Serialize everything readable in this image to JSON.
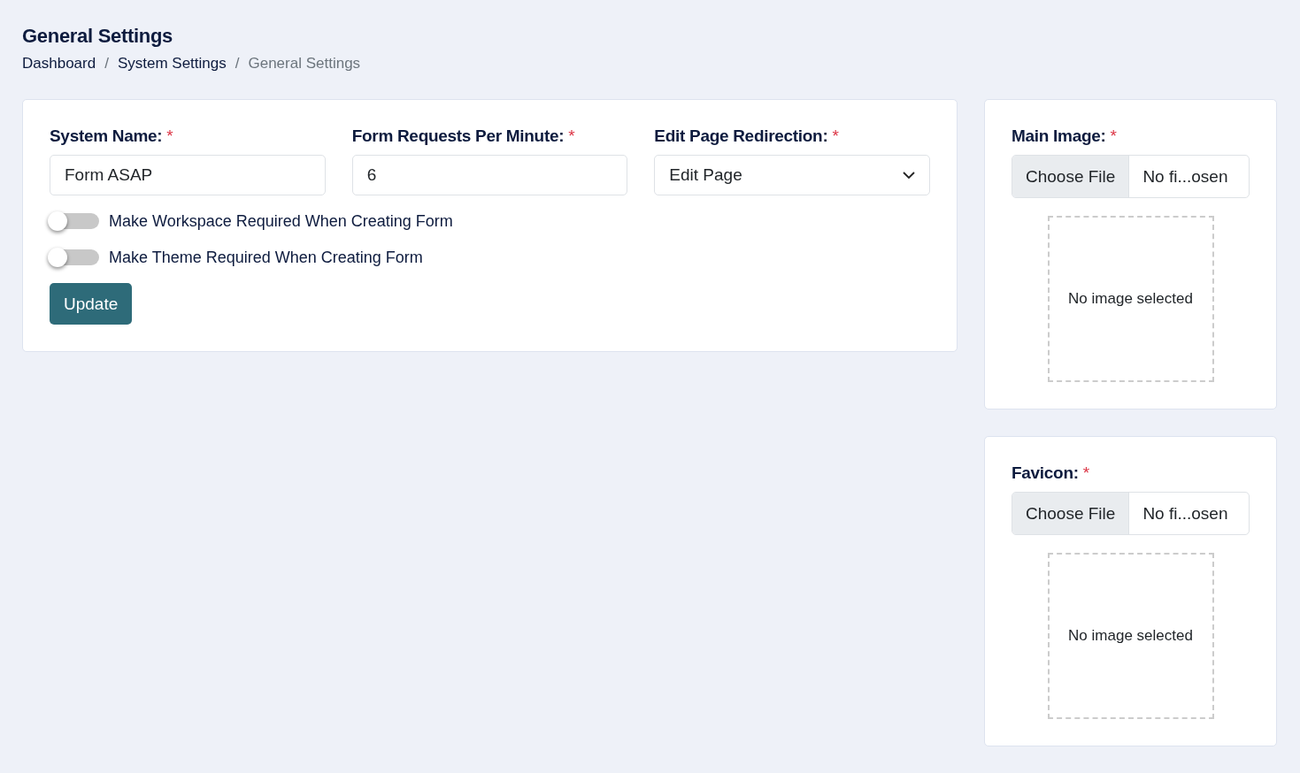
{
  "page_title": "General Settings",
  "breadcrumb": [
    {
      "label": "Dashboard",
      "current": false
    },
    {
      "label": "System Settings",
      "current": false
    },
    {
      "label": "General Settings",
      "current": true
    }
  ],
  "breadcrumb_separator": "/",
  "form": {
    "fields": [
      {
        "kind": "text",
        "label": "System Name:",
        "required_mark": "*",
        "value": "Form ASAP"
      },
      {
        "kind": "text",
        "label": "Form Requests Per Minute:",
        "required_mark": "*",
        "value": "6"
      },
      {
        "kind": "select",
        "label": "Edit Page Redirection:",
        "required_mark": "*",
        "value": "Edit Page"
      }
    ],
    "toggles": [
      {
        "label": "Make Workspace Required When Creating Form",
        "on": false
      },
      {
        "label": "Make Theme Required When Creating Form",
        "on": false
      }
    ],
    "submit": "Update"
  },
  "uploads": [
    {
      "label": "Main Image:",
      "required_mark": "*",
      "button": "Choose File",
      "file_name": "No fi...osen",
      "preview": "No image selected"
    },
    {
      "label": "Favicon:",
      "required_mark": "*",
      "button": "Choose File",
      "file_name": "No fi...osen",
      "preview": "No image selected"
    }
  ]
}
